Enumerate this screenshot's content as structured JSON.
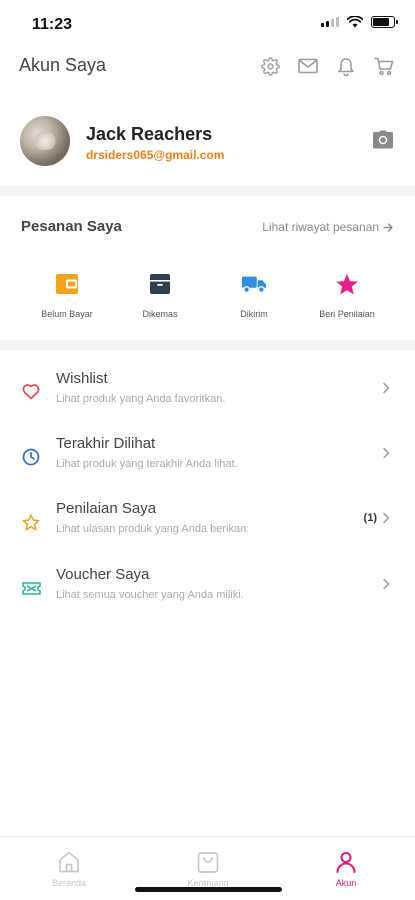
{
  "status_bar": {
    "time": "11:23"
  },
  "header": {
    "title": "Akun Saya",
    "icons": [
      "gear-icon",
      "mail-icon",
      "bell-icon",
      "cart-icon"
    ]
  },
  "profile": {
    "name": "Jack Reachers",
    "email": "drsiders065@gmail.com"
  },
  "orders": {
    "title": "Pesanan Saya",
    "history_link": "Lihat riwayat pesanan",
    "statuses": [
      {
        "label": "Belum Bayar",
        "icon": "wallet-icon",
        "color": "#f5a21b"
      },
      {
        "label": "Dikemas",
        "icon": "box-icon",
        "color": "#2f3e52"
      },
      {
        "label": "Dikirim",
        "icon": "truck-icon",
        "color": "#2f8fe0"
      },
      {
        "label": "Beri Penilaian",
        "icon": "star-icon",
        "color": "#ea1e8a"
      }
    ]
  },
  "menu": [
    {
      "title": "Wishlist",
      "subtitle": "Lihat produk yang Anda favoritkan.",
      "icon": "heart-icon",
      "color": "#e24a4a"
    },
    {
      "title": "Terakhir Dilihat",
      "subtitle": "Lihat produk yang terakhir Anda lihat.",
      "icon": "clock-icon",
      "color": "#2f6fd1"
    },
    {
      "title": "Penilaian Saya",
      "subtitle": "Lihat ulasan produk yang Anda berikan.",
      "icon": "star-outline-icon",
      "color": "#f0a020",
      "count": "(1)"
    },
    {
      "title": "Voucher Saya",
      "subtitle": "Lihat semua voucher yang Anda miliki.",
      "icon": "ticket-icon",
      "color": "#1fb58a"
    }
  ],
  "bottom_nav": [
    {
      "label": "Beranda",
      "icon": "home-icon"
    },
    {
      "label": "Keranjang",
      "icon": "bag-icon"
    },
    {
      "label": "Akun",
      "icon": "user-icon",
      "active": true
    }
  ],
  "colors": {
    "accent": "#e3197c",
    "email": "#e8811a"
  }
}
